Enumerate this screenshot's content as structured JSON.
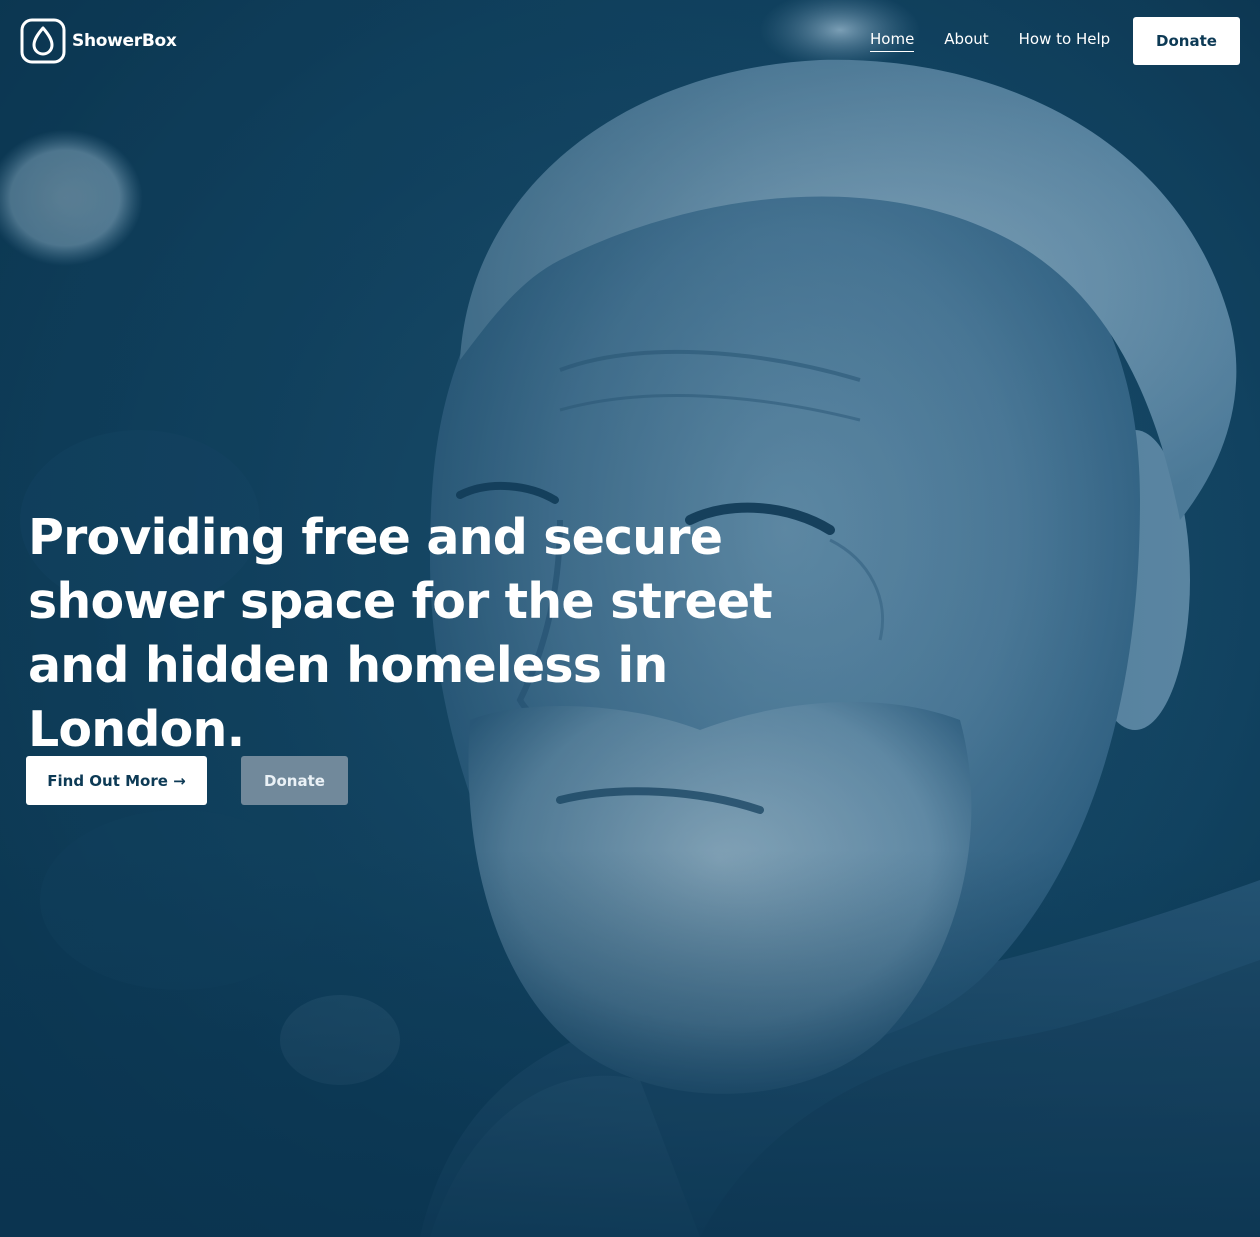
{
  "brand": {
    "name": "ShowerBox",
    "logo_icon": "water-drop-icon"
  },
  "nav": {
    "items": [
      {
        "label": "Home",
        "active": true
      },
      {
        "label": "About",
        "active": false
      },
      {
        "label": "How to Help",
        "active": false
      }
    ],
    "donate_label": "Donate"
  },
  "hero": {
    "headline": "Providing free and secure shower space for the street and hidden homeless in London.",
    "primary_cta": "Find Out More →",
    "secondary_cta": "Donate",
    "image": "portrait-photo"
  },
  "colors": {
    "overlay": "#0d3a55",
    "text": "#ffffff",
    "button_text": "#0d3a55",
    "secondary_button": "#71899b"
  }
}
